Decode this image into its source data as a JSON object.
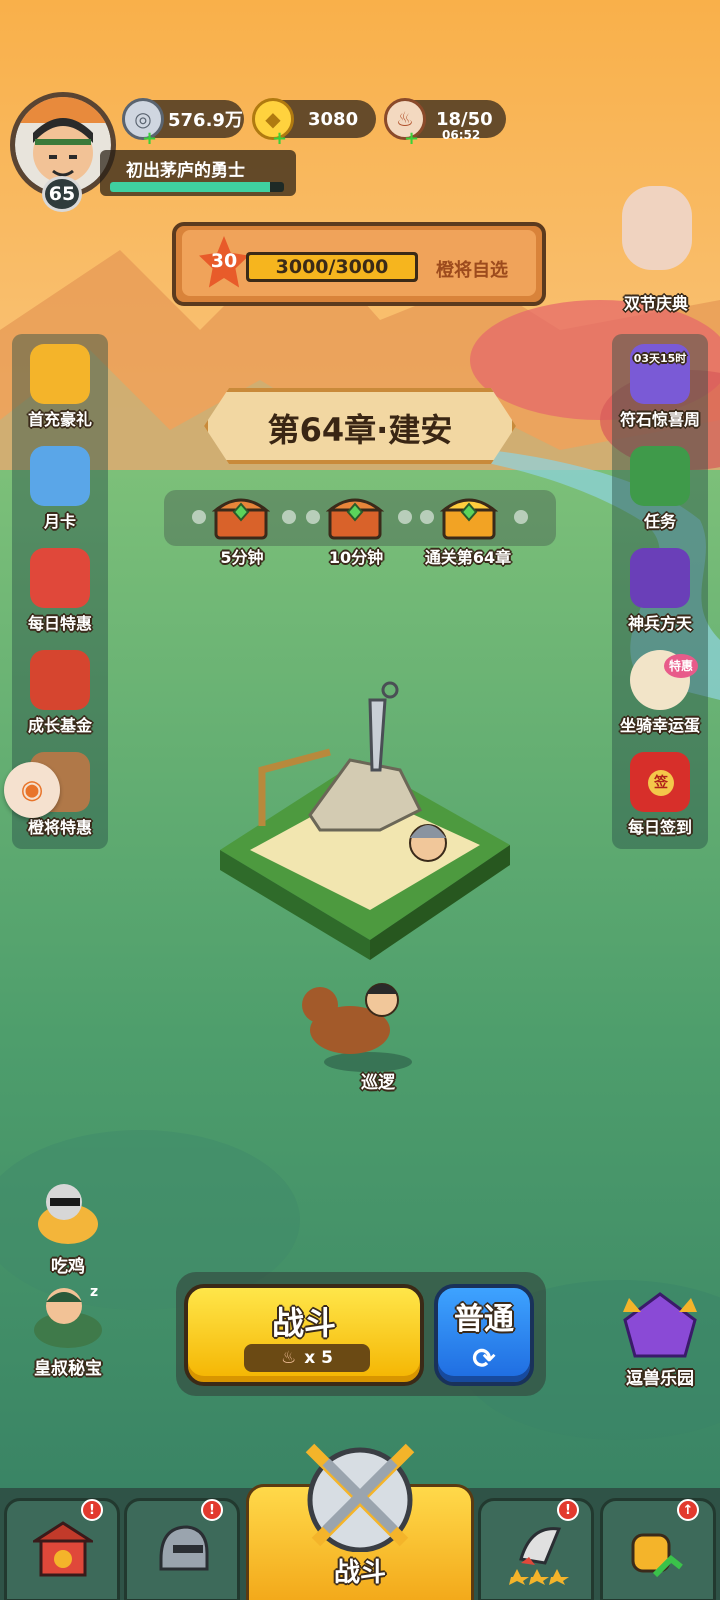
{
  "player": {
    "level": "65",
    "title": "初出茅庐的勇士",
    "exp_fraction": 0.92
  },
  "resources": {
    "silver": {
      "value": "576.9万",
      "icon": "silver-coin-icon"
    },
    "gold": {
      "value": "3080",
      "icon": "gold-ingot-icon"
    },
    "stamina": {
      "value": "18/50",
      "icon": "meat-drumstick-icon",
      "timer": "06:52"
    }
  },
  "chapter_progress": {
    "star_level": "30",
    "progress_text": "3000/3000",
    "progress_fraction": 1.0,
    "reward_label": "橙将自选"
  },
  "chapter": {
    "title": "第64章·建安"
  },
  "chests": [
    {
      "label": "5分钟"
    },
    {
      "label": "10分钟"
    },
    {
      "label": "通关第64章"
    }
  ],
  "left_menu": [
    {
      "label": "首充豪礼",
      "icon": "treasure-chest-icon"
    },
    {
      "label": "月卡",
      "icon": "month-card-icon"
    },
    {
      "label": "每日特惠",
      "icon": "gift-bag-icon"
    },
    {
      "label": "成长基金",
      "icon": "growth-fund-icon"
    },
    {
      "label": "橙将特惠",
      "icon": "orange-general-icon"
    }
  ],
  "right_menu": [
    {
      "label": "双节庆典",
      "icon": "festival-icon"
    },
    {
      "label": "符石惊喜周",
      "icon": "rune-stone-icon",
      "timer": "03天15时"
    },
    {
      "label": "任务",
      "icon": "task-scroll-icon"
    },
    {
      "label": "神兵方天",
      "icon": "halberd-icon"
    },
    {
      "label": "坐骑幸运蛋",
      "icon": "mount-egg-icon",
      "tag": "特惠"
    },
    {
      "label": "每日签到",
      "icon": "sign-in-icon",
      "tag": "签"
    }
  ],
  "stage": {
    "patrol_label": "巡逻"
  },
  "left_features": [
    {
      "label": "吃鸡"
    },
    {
      "label": "皇叔秘宝"
    }
  ],
  "battle": {
    "label": "战斗",
    "cost": "x 5",
    "mode": "普通"
  },
  "right_feature": {
    "label": "逗兽乐园"
  },
  "nav": {
    "center_label": "战斗"
  },
  "colors": {
    "sky": "#f6b35a",
    "grass": "#4fa06a",
    "accent_yellow": "#f4b400",
    "accent_blue": "#1e6be0"
  }
}
